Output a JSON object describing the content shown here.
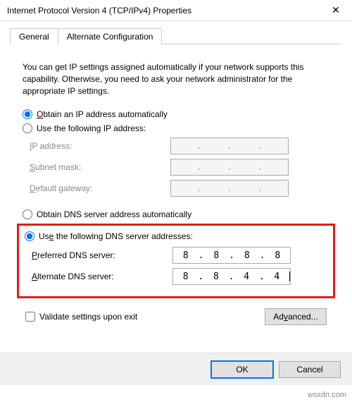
{
  "window": {
    "title": "Internet Protocol Version 4 (TCP/IPv4) Properties",
    "close_glyph": "✕"
  },
  "tabs": {
    "general": "General",
    "alternate": "Alternate Configuration"
  },
  "description": "You can get IP settings assigned automatically if your network supports this capability. Otherwise, you need to ask your network administrator for the appropriate IP settings.",
  "ip_section": {
    "auto_label_pre": "O",
    "auto_label_rest": "btain an IP address automatically",
    "manual_label_pre": "U",
    "manual_label_rest": "se the following IP address:",
    "ip_label_pre": "I",
    "ip_label_rest": "P address:",
    "subnet_label_pre": "S",
    "subnet_label_rest": "ubnet mask:",
    "gateway_label_pre": "D",
    "gateway_label_rest": "efault gateway:",
    "dots": [
      "",
      "",
      "",
      ""
    ]
  },
  "dns_section": {
    "auto_label_pre": "O",
    "auto_label_rest": "btain DNS server address automatically",
    "manual_label_pre": "Us",
    "manual_label_underline": "e",
    "manual_label_rest": " the following DNS server addresses:",
    "preferred_label_pre": "P",
    "preferred_label_rest": "referred DNS server:",
    "alternate_label_pre": "A",
    "alternate_label_rest": "lternate DNS server:",
    "preferred": [
      "8",
      "8",
      "8",
      "8"
    ],
    "alternate": [
      "8",
      "8",
      "4",
      "4"
    ]
  },
  "validate_label_pre": "V",
  "validate_label_rest": "alidate settings upon exit",
  "advanced_label_pre": "Ad",
  "advanced_label_underline": "v",
  "advanced_label_rest": "anced...",
  "buttons": {
    "ok": "OK",
    "cancel": "Cancel"
  },
  "watermark": "wsxdn.com"
}
